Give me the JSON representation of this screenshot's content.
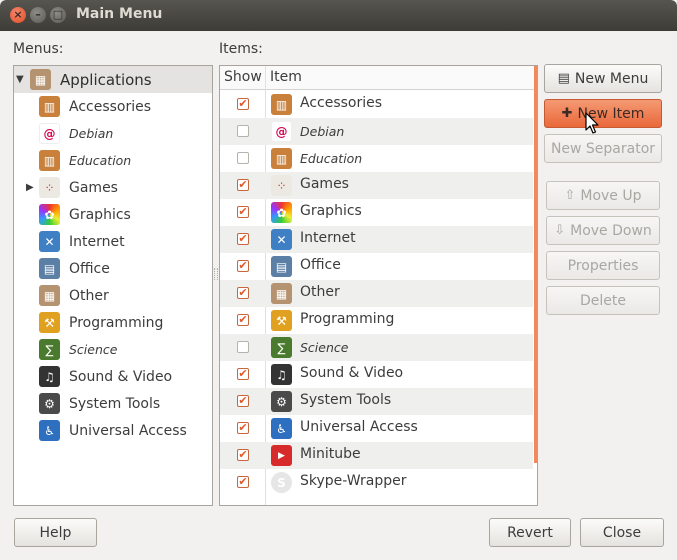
{
  "window": {
    "title": "Main Menu"
  },
  "labels": {
    "menus": "Menus:",
    "items": "Items:"
  },
  "menus": [
    {
      "label": "Applications",
      "icon": "applications-icon",
      "color": "#b59370",
      "selected": true,
      "expandable": true,
      "expanded": true,
      "italic": false
    },
    {
      "label": "Accessories",
      "icon": "accessories-icon",
      "color": "#c8803a",
      "italic": false
    },
    {
      "label": "Debian",
      "icon": "debian-icon",
      "color": "#d70751",
      "italic": true
    },
    {
      "label": "Education",
      "icon": "education-icon",
      "color": "#c8803a",
      "italic": true
    },
    {
      "label": "Games",
      "icon": "games-icon",
      "color": "#b9b6ae",
      "italic": false,
      "expandable": true
    },
    {
      "label": "Graphics",
      "icon": "graphics-icon",
      "color": "#7a52c8",
      "italic": false
    },
    {
      "label": "Internet",
      "icon": "internet-icon",
      "color": "#3f7fc4",
      "italic": false
    },
    {
      "label": "Office",
      "icon": "office-icon",
      "color": "#5c7fa6",
      "italic": false
    },
    {
      "label": "Other",
      "icon": "other-icon",
      "color": "#b59370",
      "italic": false
    },
    {
      "label": "Programming",
      "icon": "programming-icon",
      "color": "#e0a020",
      "italic": false
    },
    {
      "label": "Science",
      "icon": "science-icon",
      "color": "#4a7a2e",
      "italic": true
    },
    {
      "label": "Sound & Video",
      "icon": "sound-video-icon",
      "color": "#333333",
      "italic": false
    },
    {
      "label": "System Tools",
      "icon": "system-tools-icon",
      "color": "#4a4a4a",
      "italic": false
    },
    {
      "label": "Universal Access",
      "icon": "universal-access-icon",
      "color": "#2f6fc0",
      "italic": false
    }
  ],
  "items_table": {
    "columns": [
      "Show",
      "Item"
    ],
    "rows": [
      {
        "show": true,
        "label": "Accessories",
        "icon": "accessories-icon",
        "color": "#c8803a",
        "italic": false
      },
      {
        "show": false,
        "label": "Debian",
        "icon": "debian-icon",
        "color": "#d70751",
        "italic": true
      },
      {
        "show": false,
        "label": "Education",
        "icon": "education-icon",
        "color": "#c8803a",
        "italic": true
      },
      {
        "show": true,
        "label": "Games",
        "icon": "games-icon",
        "color": "#b9b6ae",
        "italic": false
      },
      {
        "show": true,
        "label": "Graphics",
        "icon": "graphics-icon",
        "color": "#7a52c8",
        "italic": false
      },
      {
        "show": true,
        "label": "Internet",
        "icon": "internet-icon",
        "color": "#3f7fc4",
        "italic": false
      },
      {
        "show": true,
        "label": "Office",
        "icon": "office-icon",
        "color": "#5c7fa6",
        "italic": false
      },
      {
        "show": true,
        "label": "Other",
        "icon": "other-icon",
        "color": "#b59370",
        "italic": false
      },
      {
        "show": true,
        "label": "Programming",
        "icon": "programming-icon",
        "color": "#e0a020",
        "italic": false
      },
      {
        "show": false,
        "label": "Science",
        "icon": "science-icon",
        "color": "#4a7a2e",
        "italic": true
      },
      {
        "show": true,
        "label": "Sound & Video",
        "icon": "sound-video-icon",
        "color": "#333333",
        "italic": false
      },
      {
        "show": true,
        "label": "System Tools",
        "icon": "system-tools-icon",
        "color": "#4a4a4a",
        "italic": false
      },
      {
        "show": true,
        "label": "Universal Access",
        "icon": "universal-access-icon",
        "color": "#2f6fc0",
        "italic": false
      },
      {
        "show": true,
        "label": "Minitube",
        "icon": "minitube-icon",
        "color": "#d72b2b",
        "italic": false
      },
      {
        "show": true,
        "label": "Skype-Wrapper",
        "icon": "skype-icon",
        "color": "#cfcfcf",
        "italic": false
      }
    ]
  },
  "side_buttons": {
    "new_menu": "New Menu",
    "new_item": "New Item",
    "new_separator": "New Separator",
    "move_up": "Move Up",
    "move_down": "Move Down",
    "properties": "Properties",
    "delete": "Delete"
  },
  "footer": {
    "help": "Help",
    "revert": "Revert",
    "close": "Close"
  },
  "colors": {
    "accent": "#f08a5d",
    "checkmark": "#e0572a",
    "titlebar": "#3d3c37"
  }
}
